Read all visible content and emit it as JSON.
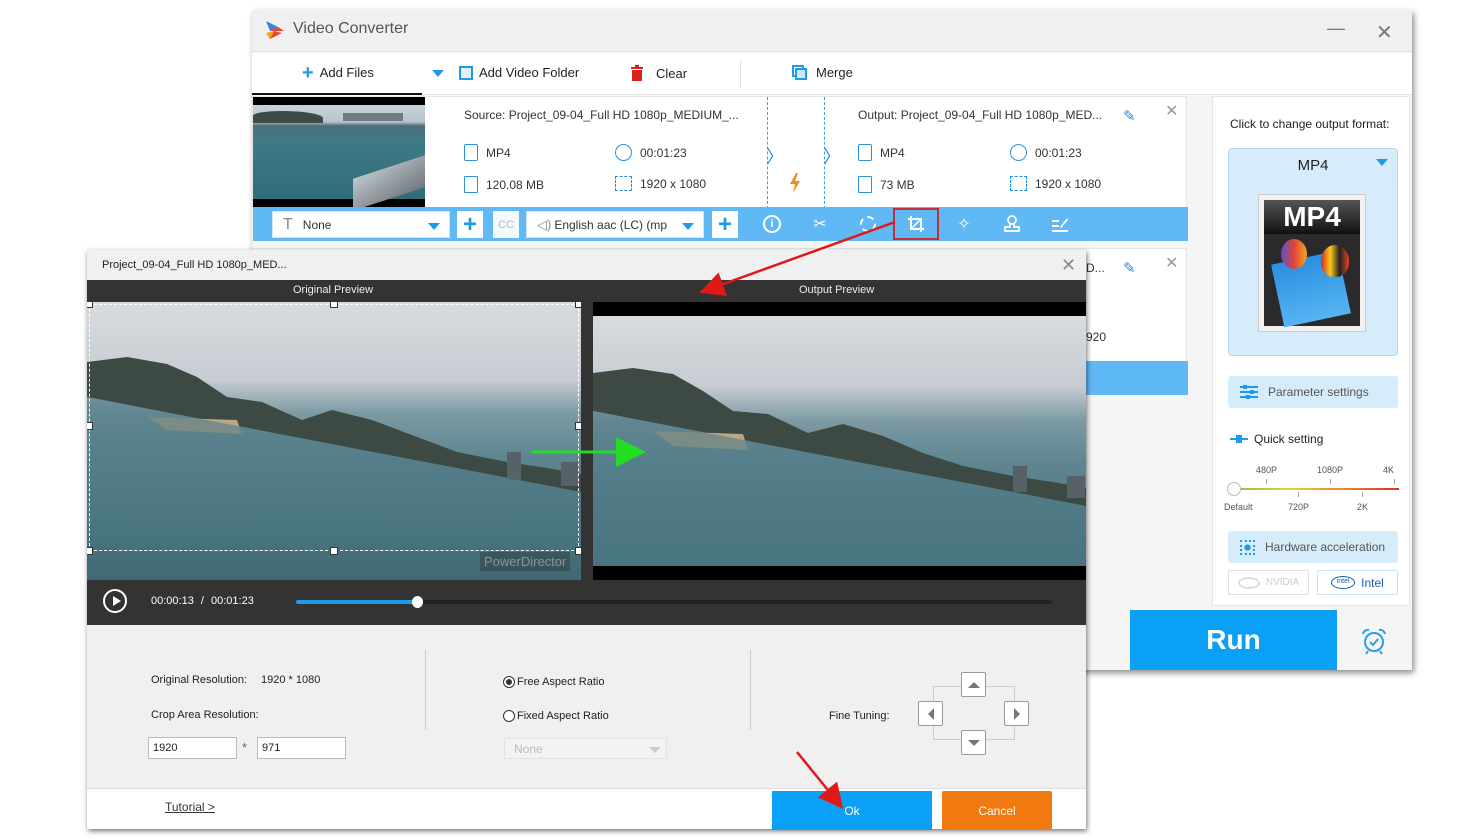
{
  "app": {
    "title": "Video Converter",
    "minimize": "—",
    "close": "✕"
  },
  "toolbar": {
    "add_files": "Add Files",
    "add_video_folder": "Add Video Folder",
    "clear": "Clear",
    "merge": "Merge"
  },
  "file_rows": [
    {
      "source_name": "Source: Project_09-04_Full HD 1080p_MEDIUM_...",
      "source_format": "MP4",
      "source_duration": "00:01:23",
      "source_size": "120.08 MB",
      "source_resolution": "1920 x 1080",
      "output_name": "Output: Project_09-04_Full HD 1080p_MED...",
      "output_format": "MP4",
      "output_duration": "00:01:23",
      "output_size": "73 MB",
      "output_resolution": "1920 x 1080"
    },
    {
      "output_name_partial": "D...",
      "output_resolution_partial": "920"
    }
  ],
  "edit_bar": {
    "subtitle_select": "None",
    "audio_select": "English aac (LC) (mp",
    "cc_label": "CC"
  },
  "right_panel": {
    "format_label": "Click to change output format:",
    "format_name": "MP4",
    "format_image_text": "MP4",
    "parameter_settings": "Parameter settings",
    "quick_setting": "Quick setting",
    "quality_ticks_top": [
      "480P",
      "1080P",
      "4K"
    ],
    "quality_ticks_bottom": [
      "Default",
      "720P",
      "2K"
    ],
    "quality_selected": "Default",
    "hardware_acceleration": "Hardware acceleration",
    "nvidia": "NVIDIA",
    "intel": "Intel",
    "run": "Run"
  },
  "dialog": {
    "title": "Project_09-04_Full HD 1080p_MED...",
    "original_preview": "Original Preview",
    "output_preview": "Output Preview",
    "watermark": "PowerDirector",
    "current_time": "00:00:13",
    "time_separator": "/",
    "total_time": "00:01:23",
    "progress_fraction": 0.16,
    "original_resolution_label": "Original Resolution:",
    "original_resolution_value": "1920 * 1080",
    "crop_area_label": "Crop Area Resolution:",
    "crop_width": "1920",
    "crop_height": "971",
    "crop_separator": "*",
    "free_aspect": "Free Aspect Ratio",
    "fixed_aspect": "Fixed Aspect Ratio",
    "aspect_selected": "free",
    "aspect_select_value": "None",
    "fine_tuning": "Fine Tuning:",
    "tutorial": "Tutorial >",
    "ok": "Ok",
    "cancel": "Cancel"
  },
  "colors": {
    "accent_blue": "#0aa0f6",
    "edit_bar_blue": "#60b8f5",
    "cancel_orange": "#f07a10",
    "highlight_red": "#c0303a",
    "annotation_green": "#22dd22"
  }
}
